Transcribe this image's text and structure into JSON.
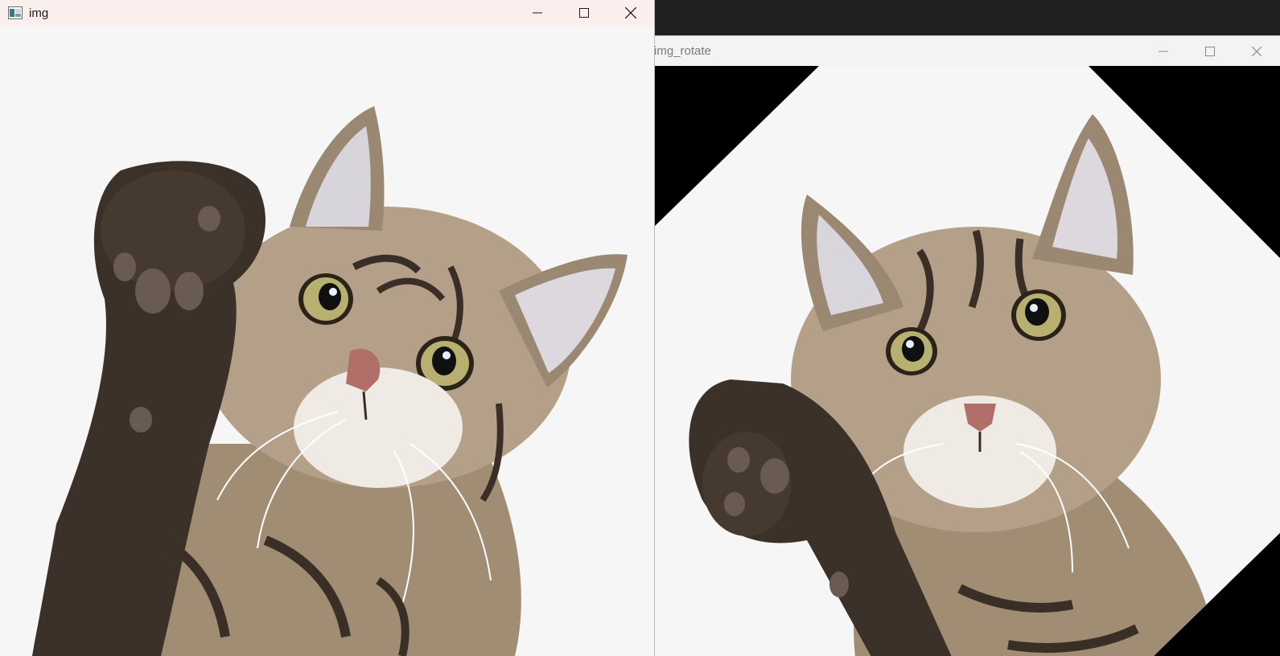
{
  "windows": {
    "original": {
      "title": "img",
      "controls": {
        "minimize": "minimize",
        "maximize": "maximize",
        "close": "close"
      }
    },
    "rotated": {
      "title": "img_rotate",
      "controls": {
        "minimize": "minimize",
        "maximize": "maximize",
        "close": "close"
      },
      "rotation_degrees": 45
    }
  },
  "colors": {
    "desktop": "#202020",
    "left_titlebar": "#fbefee",
    "image_background": "#f6f6f6",
    "rotated_fill": "#000000",
    "fur_light": "#b9a58d",
    "fur_dark": "#3c3128",
    "eye_iris": "#b8b070",
    "nose": "#b26f6a"
  }
}
